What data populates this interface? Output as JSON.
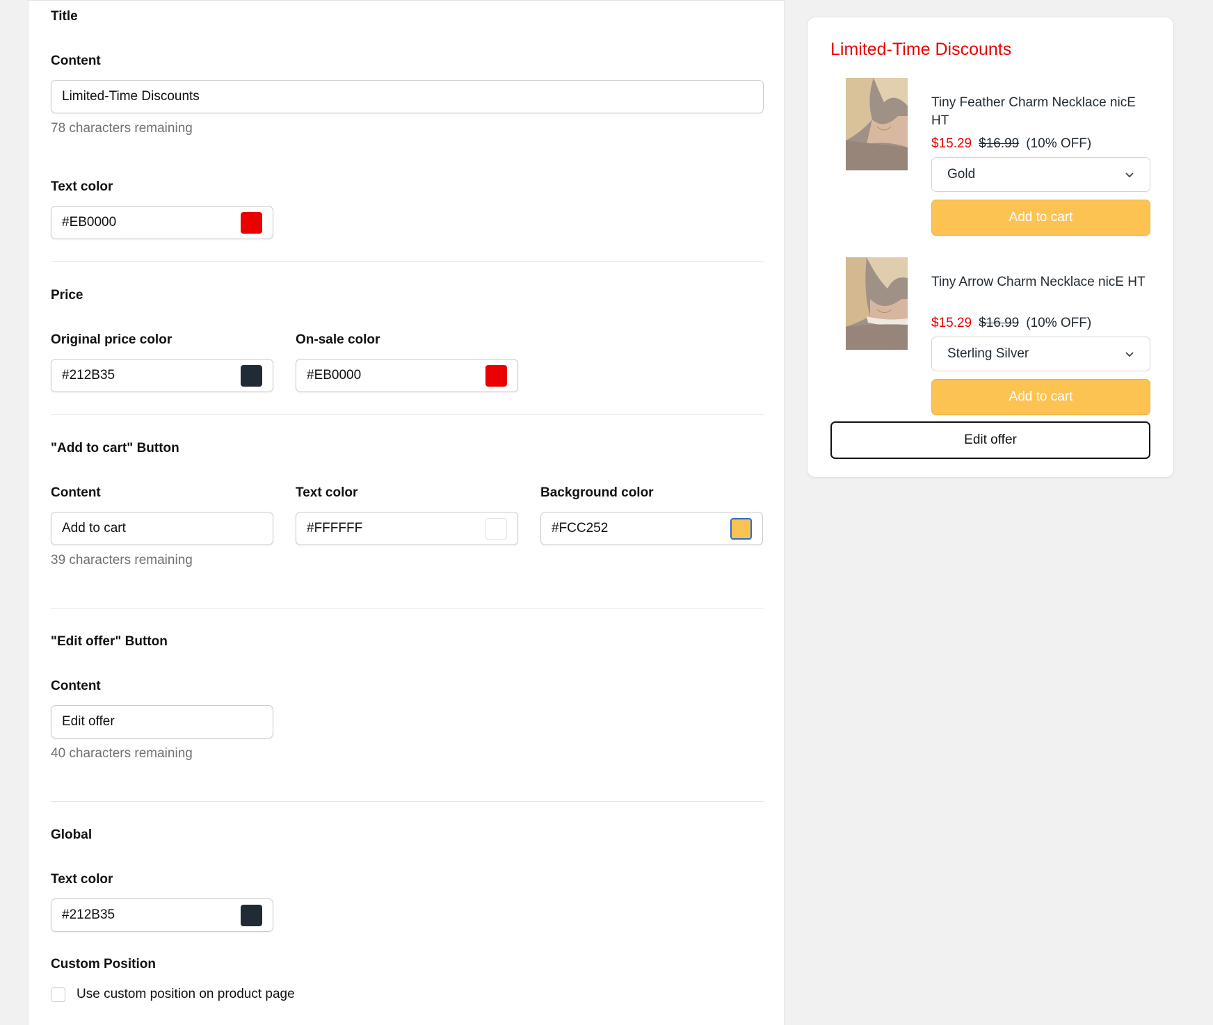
{
  "colors": {
    "title_color": "#EB0000",
    "sale_color": "#EB0000",
    "original_price_color": "#212B35",
    "button_text_color": "#FFFFFF",
    "button_bg_color": "#FCC252",
    "global_text_color": "#212B35"
  },
  "settings": {
    "title_section": {
      "heading": "Title",
      "content_label": "Content",
      "content_value": "Limited-Time Discounts",
      "content_helper": "78 characters remaining",
      "text_color_label": "Text color",
      "text_color_value": "#EB0000"
    },
    "price_section": {
      "heading": "Price",
      "original_label": "Original price color",
      "original_value": "#212B35",
      "onsale_label": "On-sale color",
      "onsale_value": "#EB0000"
    },
    "atc_section": {
      "heading": "\"Add to cart\" Button",
      "content_label": "Content",
      "content_value": "Add to cart",
      "content_helper": "39 characters remaining",
      "text_color_label": "Text color",
      "text_color_value": "#FFFFFF",
      "bg_color_label": "Background color",
      "bg_color_value": "#FCC252"
    },
    "edit_section": {
      "heading": "\"Edit offer\" Button",
      "content_label": "Content",
      "content_value": "Edit offer",
      "content_helper": "40 characters remaining"
    },
    "global_section": {
      "heading": "Global",
      "text_color_label": "Text color",
      "text_color_value": "#212B35"
    },
    "custom_position": {
      "heading": "Custom Position",
      "checkbox_label": "Use custom position on product page",
      "checked": false
    }
  },
  "preview": {
    "title": "Limited-Time Discounts",
    "products": [
      {
        "name": "Tiny Feather Charm Necklace nicE HT",
        "sale_price": "$15.29",
        "original_price": "$16.99",
        "discount": "(10% OFF)",
        "variant": "Gold",
        "button": "Add to cart"
      },
      {
        "name": "Tiny Arrow Charm Necklace nicE HT",
        "sale_price": "$15.29",
        "original_price": "$16.99",
        "discount": "(10% OFF)",
        "variant": "Sterling Silver",
        "button": "Add to cart"
      }
    ],
    "edit_button": "Edit offer"
  }
}
